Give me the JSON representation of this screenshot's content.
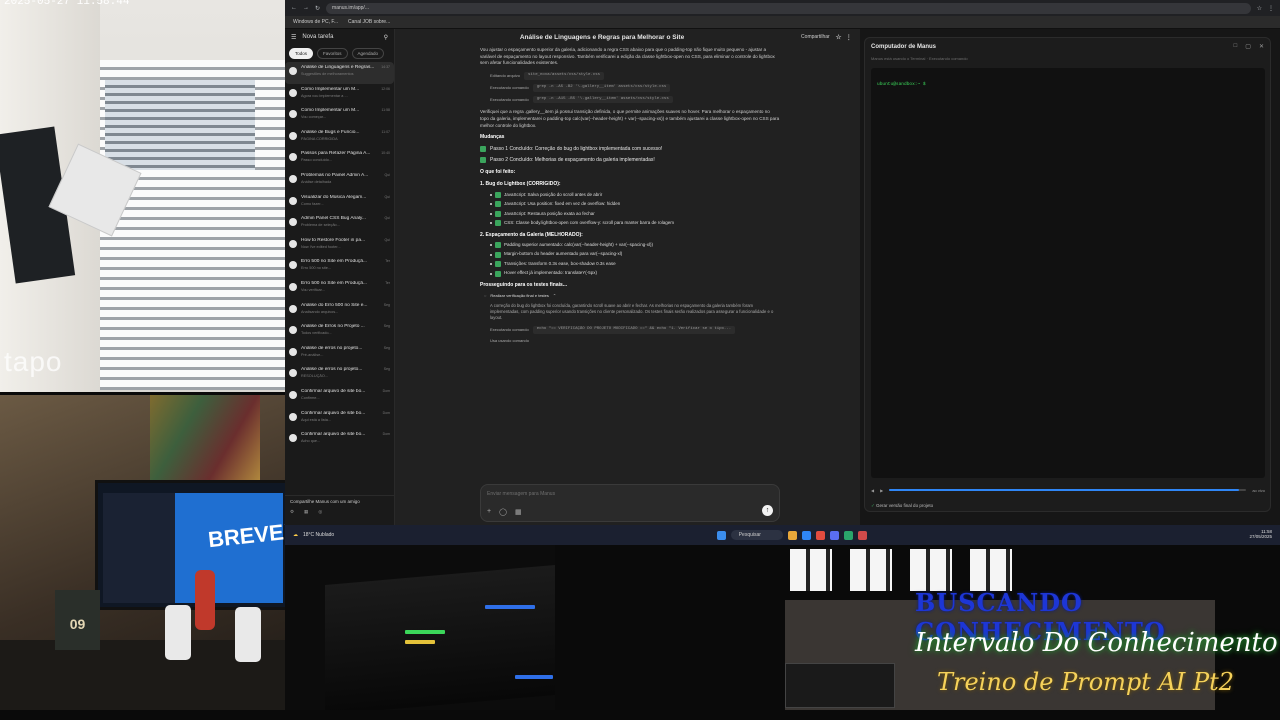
{
  "camera": {
    "watermark": "tapo",
    "timestamp": "2025-05-27 11:58:44"
  },
  "desk": {
    "monitor_text": "BREVE!",
    "box_label": "09"
  },
  "overlay": {
    "title": "BUSCANDO CONHECIMENTO",
    "subtitle1": "Intervalo Do Conhecimento",
    "subtitle2": "Treino de Prompt AI Pt2"
  },
  "browser": {
    "url": "manus.im/app/...",
    "bookmarks": [
      "Windows de PC, F...",
      "Canal JOB sobre..."
    ]
  },
  "sidebar": {
    "new_task": "Nova tarefa",
    "filters": [
      "Todos",
      "Favoritos",
      "Agendado"
    ],
    "tasks": [
      {
        "title": "Análise de Linguagens e Regras...",
        "sub": "Suggestões de melhoramentos",
        "time": "14:37",
        "active": true
      },
      {
        "title": "Como Implementar um M...",
        "sub": "Agora vou implementar a ...",
        "time": "12:06"
      },
      {
        "title": "Como Implementar um M...",
        "sub": "Vou começar...",
        "time": "11:58"
      },
      {
        "title": "Análise de Bugs e Funcio...",
        "sub": "PÁGINA CORRIGIDA",
        "time": "11:07"
      },
      {
        "title": "Passos para Refazer Página A...",
        "sub": "Passo concluído...",
        "time": "10:40"
      },
      {
        "title": "Problemas no Painel Admin A...",
        "sub": "Análise detalhada",
        "time": "Qui"
      },
      {
        "title": "Visualizar do Música Alegam...",
        "sub": "Como fazer...",
        "time": "Qui"
      },
      {
        "title": "Admin Panel CSS Bug Analy...",
        "sub": "Problema de seleção...",
        "time": "Qui"
      },
      {
        "title": "How to Restore Footer in pa...",
        "sub": "Now I've edited footer...",
        "time": "Qui"
      },
      {
        "title": "Erro 500 no Site em Produçã...",
        "sub": "Erro 500 no site...",
        "time": "Ter"
      },
      {
        "title": "Erro 500 no Site em Produçã...",
        "sub": "Vou verificar...",
        "time": "Ter"
      },
      {
        "title": "Análise do Erro 500 no Site e...",
        "sub": "Analisando arquivos...",
        "time": "Seg"
      },
      {
        "title": "Análise de Erros no Projeto ...",
        "sub": "Todos verificado...",
        "time": "Seg"
      },
      {
        "title": "Análise de erros no projeto...",
        "sub": "Pré-análise...",
        "time": "Seg"
      },
      {
        "title": "Análise de erros no projeto...",
        "sub": "RESOLUÇÃO...",
        "time": "Seg"
      },
      {
        "title": "Confirmar arquivo de site bo...",
        "sub": "Confirme...",
        "time": "Dom"
      },
      {
        "title": "Confirmar arquivo de site bo...",
        "sub": "Aqui está a lista...",
        "time": "Dom"
      },
      {
        "title": "Confirmar arquivo de site bo...",
        "sub": "Acho que...",
        "time": "Dom"
      }
    ],
    "bottom": "Compartilhe Manus com um amigo"
  },
  "chat": {
    "title": "Análise de Linguagens e Regras para Melhorar o Site",
    "share": "Compartilhar",
    "intro": "Vou ajustar o espaçamento superior da galeria, adicionando a regra CSS abaixo para que o padding-top não fique muito pequeno - ajustar a variável de espaçamento no layout responsivo. Também verificarei a edição da classe lightbox-open no CSS, para eliminar o controle do lightbox sem afetar funcionalidades existentes.",
    "commands": [
      {
        "label": "Editando arquivo",
        "code": "site_nova/assets/css/style.css"
      },
      {
        "label": "Executando comando",
        "code": "grep -n -A5 -B2 '\\.gallery__item' assets/css/style.css"
      },
      {
        "label": "Executando comando",
        "code": "grep -n -A15 -B5 '\\.gallery__item' assets/css/style.css"
      }
    ],
    "para2": "Verifiquei que a regra .gallery__item já possui transição definida, o que permite animações suaves no hover. Para melhorar o espaçamento no topo da galeria, implementarei o padding-top calc(var(--header-height) + var(--spacing-xs)) e também ajustarei a classe lightbox-open no CSS para melhor controle do lightbox.",
    "section": "Mudanças",
    "steps": [
      "Passo 1 Concluído: Correção do bug do lightbox implementada com sucesso!",
      "Passo 2 Concluído: Melhorias de espaçamento da galeria implementadas!"
    ],
    "done_label": "O que foi feito:",
    "h1": "1. Bug do Lightbox (CORRIGIDO):",
    "items1": [
      "JavaScript: Salva posição do scroll antes de abrir",
      "JavaScript: Usa position: fixed em vez de overflow: hidden",
      "JavaScript: Restaura posição exata ao fechar",
      "CSS: Classe body.lightbox-open com overflow-y: scroll para manter barra de rolagem"
    ],
    "h2": "2. Espaçamento da Galeria (MELHORADO):",
    "items2": [
      "Padding superior aumentado: calc(var(--header-height) + var(--spacing-xl))",
      "Margin-bottom do header aumentado para var(--spacing-xl)",
      "Transições: transform 0.3s ease, box-shadow 0.3s ease",
      "Hover effect já implementado: translateY(-5px)"
    ],
    "next": "Prosseguindo para os testes finais...",
    "verify": "Realizar verificação final e testes",
    "para3": "A correção do bug do lightbox foi concluída, garantindo scroll suave ao abrir e fechar. As melhorias no espaçamento da galeria também foram implementadas, com padding superior usando transições no cliente personalizado. Os testes finais serão realizados para assegurar a funcionalidade e o layout.",
    "cmd_last": {
      "label": "Executando comando",
      "code": "echo \"== VERIFICAÇÃO DO PROJETO MODIFICADO ==\" && echo \"1. Verificar se o tipo..."
    },
    "cmd_end": "Usa usando comando",
    "placeholder": "Enviar mensagem para Manus"
  },
  "computer": {
    "title": "Computador de Manus",
    "sub": "Manus está usando o Terminal · Executando comando",
    "prompt": "ubuntu@sandbox:~ $",
    "time": "ao vivo",
    "progress": 0.98,
    "task": "Gerar versão final do projeto"
  },
  "taskbar": {
    "weather": "18°C Nublado",
    "search": "Pesquisar",
    "clock": "11:58",
    "date": "27/05/2025"
  }
}
